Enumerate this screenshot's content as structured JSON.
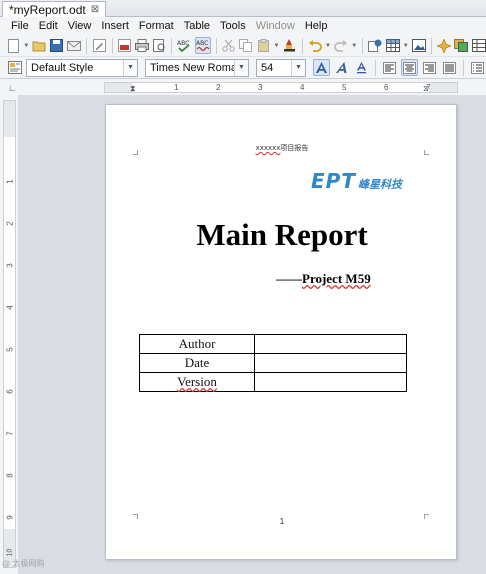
{
  "tab": {
    "title": "*myReport.odt",
    "close_glyph": "⊠"
  },
  "menu": [
    "File",
    "Edit",
    "View",
    "Insert",
    "Format",
    "Table",
    "Tools",
    "Window",
    "Help"
  ],
  "menu_disabled": [
    "Window"
  ],
  "format_bar": {
    "paragraph_style": "Default Style",
    "font_name": "Times New Roman",
    "font_size": "54"
  },
  "ruler": {
    "h_numbers": [
      "1",
      "2",
      "3",
      "4",
      "5",
      "6",
      "7"
    ],
    "v_numbers": [
      "1",
      "2",
      "3",
      "4",
      "5",
      "6",
      "7",
      "8",
      "9",
      "10"
    ]
  },
  "document": {
    "header_squiggle": "xxxxxx",
    "header_text": "项目报告",
    "logo_ept": "EPT",
    "logo_cn": "峰星科技",
    "title": "Main Report",
    "subtitle_prefix": "——",
    "subtitle_main": "Project M59",
    "table_rows": [
      {
        "label": "Author",
        "value": ""
      },
      {
        "label": "Date",
        "value": ""
      },
      {
        "label": "Version",
        "value": ""
      }
    ],
    "page_number": "1"
  },
  "watermark": "@ 太极网购"
}
